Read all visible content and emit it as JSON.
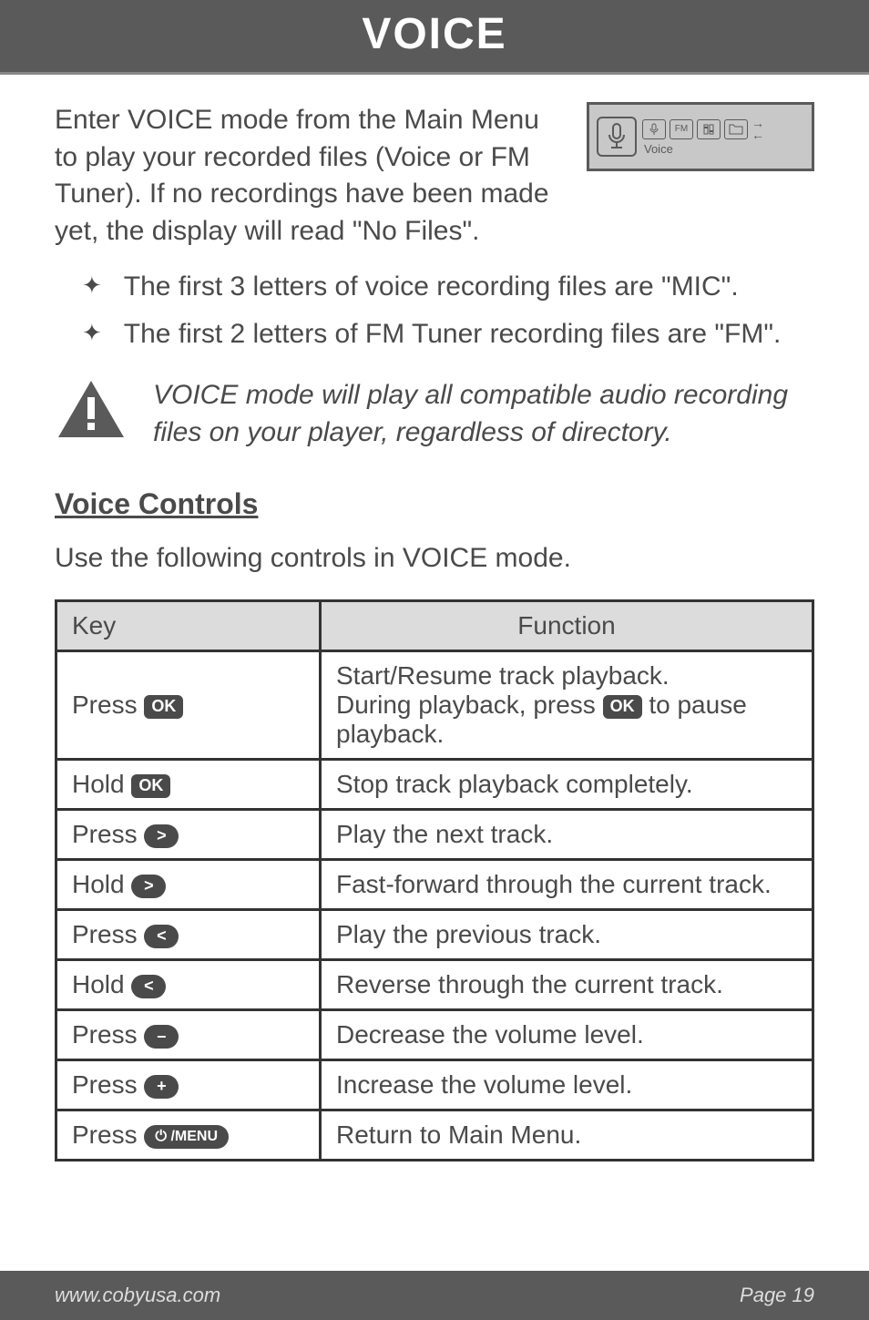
{
  "header": {
    "title": "VOICE"
  },
  "intro": "Enter VOICE mode from the Main Menu to play your recorded files (Voice or FM Tuner). If no recordings have been made yet, the display will read \"No Files\".",
  "screen": {
    "label": "Voice",
    "icons": {
      "mic": "🎤",
      "radio": "FM",
      "settings": "⚙",
      "folder": "📁"
    }
  },
  "bullets": [
    "The first 3 letters of voice recording files are \"MIC\".",
    "The first 2 letters of FM Tuner recording files are \"FM\"."
  ],
  "note": "VOICE mode will play all compatible audio recording files on your player, regardless of directory.",
  "section": {
    "title": "Voice Controls",
    "sub": "Use the following controls in VOICE mode."
  },
  "table": {
    "headers": {
      "key": "Key",
      "function": "Function"
    },
    "rows": [
      {
        "action": "Press",
        "badge_type": "ok",
        "badge": "OK",
        "func_pre": "Start/Resume track playback.\nDuring playback, press ",
        "func_mid_badge": "OK",
        "func_post": " to pause playback."
      },
      {
        "action": "Hold",
        "badge_type": "ok",
        "badge": "OK",
        "func": "Stop track playback completely."
      },
      {
        "action": "Press",
        "badge_type": "round",
        "badge": ">",
        "func": "Play the next track."
      },
      {
        "action": "Hold",
        "badge_type": "round",
        "badge": ">",
        "func": "Fast-forward through the current track."
      },
      {
        "action": "Press",
        "badge_type": "round",
        "badge": "<",
        "func": "Play the previous track."
      },
      {
        "action": "Hold",
        "badge_type": "round",
        "badge": "<",
        "func": "Reverse through the current track."
      },
      {
        "action": "Press",
        "badge_type": "round",
        "badge": "–",
        "func": "Decrease the volume level."
      },
      {
        "action": "Press",
        "badge_type": "round",
        "badge": "+",
        "func": "Increase the volume level."
      },
      {
        "action": "Press",
        "badge_type": "menu",
        "badge": "⏻ /MENU",
        "func": "Return to Main Menu."
      }
    ]
  },
  "footer": {
    "url": "www.cobyusa.com",
    "page": "Page 19"
  }
}
